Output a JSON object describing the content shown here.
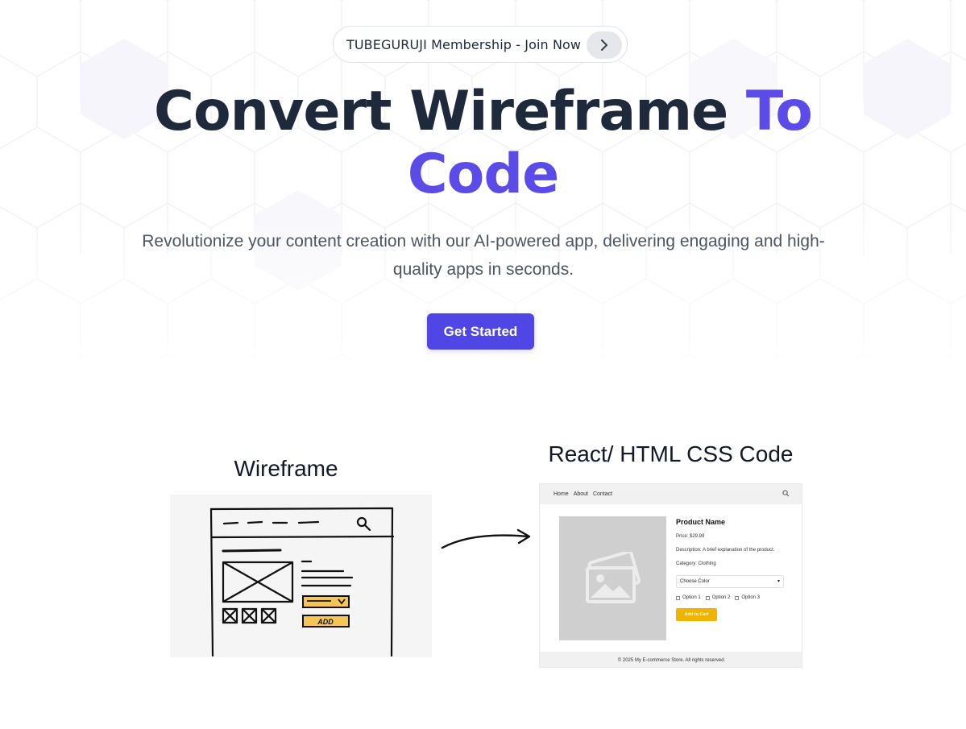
{
  "banner": {
    "text": "TUBEGURUJI Membership - Join Now",
    "chevron_icon": "chevron-right-icon"
  },
  "hero": {
    "title_main": "Convert Wireframe ",
    "title_accent_1": "To",
    "title_accent_2": "Code",
    "subtitle_line1": "Revolutionize your content creation with our AI-powered app, delivering engaging and high-",
    "subtitle_line2": "quality apps in seconds.",
    "cta_label": "Get Started"
  },
  "showcase": {
    "wireframe_label": "Wireframe",
    "wireframe_sketch_add": "ADD",
    "code_label": "React/ HTML CSS Code",
    "preview": {
      "nav": [
        "Home",
        "About",
        "Contact"
      ],
      "product_name": "Product Name",
      "price": "Price: $29.99",
      "description": "Description: A brief explanation of the product.",
      "category": "Category: Clothing",
      "select_value": "Choose Color",
      "options": [
        "Option 1",
        "Option 2",
        "Option 3"
      ],
      "add_button": "Add to Cart",
      "footer": "© 2025 My E-commerce Store. All rights reserved."
    }
  },
  "colors": {
    "accent": "#5b4be8",
    "cta_bg": "#4f46e5",
    "heading": "#1e293b",
    "body_text": "#4b5563",
    "add_to_cart": "#f0b400"
  }
}
